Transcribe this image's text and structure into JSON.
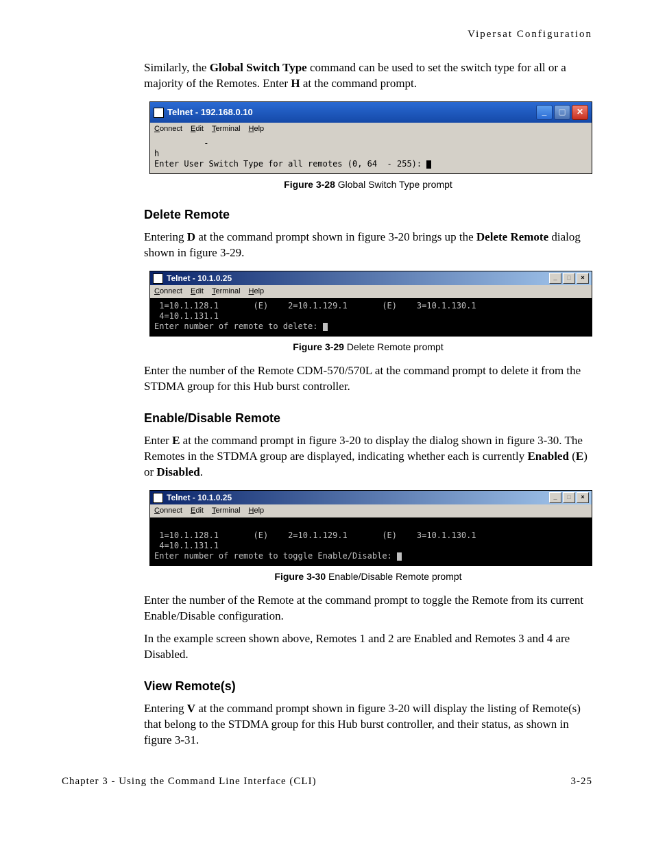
{
  "running_header": "Vipersat Configuration",
  "intro_para_parts": {
    "pre": "Similarly, the ",
    "bold1": "Global Switch Type",
    "mid": " command can be used to set the switch type for all or a majority of the Remotes. Enter ",
    "bold2": "H",
    "post": " at the command prompt."
  },
  "fig28": {
    "title": "Telnet - 192.168.0.10",
    "menu": {
      "connect": "Connect",
      "edit": "Edit",
      "terminal": "Terminal",
      "help": "Help"
    },
    "body_line1": "          -",
    "body_line2": "h",
    "body_line3": "Enter User Switch Type for all remotes (0, 64  - 255): ",
    "caption_label": "Figure 3-28",
    "caption_text": "  Global Switch Type prompt"
  },
  "heading_delete": "Delete Remote",
  "delete_para": {
    "pre": "Entering ",
    "bold1": "D",
    "mid": " at the command prompt shown in figure 3-20 brings up the ",
    "bold2": "Delete Remote",
    "post": " dialog shown in figure 3-29."
  },
  "fig29": {
    "title": "Telnet - 10.1.0.25",
    "menu": {
      "connect": "Connect",
      "edit": "Edit",
      "terminal": "Terminal",
      "help": "Help"
    },
    "body_line1": " 1=10.1.128.1       (E)    2=10.1.129.1       (E)    3=10.1.130.1",
    "body_line2": " 4=10.1.131.1",
    "body_line3": "Enter number of remote to delete: ",
    "caption_label": "Figure 3-29",
    "caption_text": "  Delete Remote prompt"
  },
  "delete_para2": "Enter the number of the Remote CDM-570/570L at the command prompt to delete it from the STDMA group for this Hub burst controller.",
  "heading_enable": "Enable/Disable Remote",
  "enable_para": {
    "pre": "Enter ",
    "bold1": "E",
    "mid1": " at the command prompt in figure 3-20 to display the dialog shown in figure 3-30. The Remotes in the STDMA group are displayed, indicating whether each is currently ",
    "bold2": "Enabled",
    "mid2": " (",
    "bold3": "E",
    "mid3": ") or ",
    "bold4": "Disabled",
    "post": "."
  },
  "fig30": {
    "title": "Telnet - 10.1.0.25",
    "menu": {
      "connect": "Connect",
      "edit": "Edit",
      "terminal": "Terminal",
      "help": "Help"
    },
    "body_line0": "",
    "body_line1": " 1=10.1.128.1       (E)    2=10.1.129.1       (E)    3=10.1.130.1",
    "body_line2": " 4=10.1.131.1",
    "body_line3": "Enter number of remote to toggle Enable/Disable: ",
    "caption_label": "Figure 3-30",
    "caption_text": "  Enable/Disable Remote prompt"
  },
  "enable_para2": "Enter the number of the Remote at the command prompt to toggle the Remote from its current Enable/Disable configuration.",
  "enable_para3": "In the example screen shown above, Remotes 1 and 2 are Enabled and Remotes 3 and 4 are Disabled.",
  "heading_view": "View Remote(s)",
  "view_para": {
    "pre": "Entering ",
    "bold1": "V",
    "post": " at the command prompt shown in figure 3-20 will display the listing of Remote(s) that belong to the STDMA group for this Hub burst controller, and their status, as shown in figure 3-31."
  },
  "footer_left": "Chapter 3 - Using the Command Line Interface (CLI)",
  "footer_right": "3-25"
}
